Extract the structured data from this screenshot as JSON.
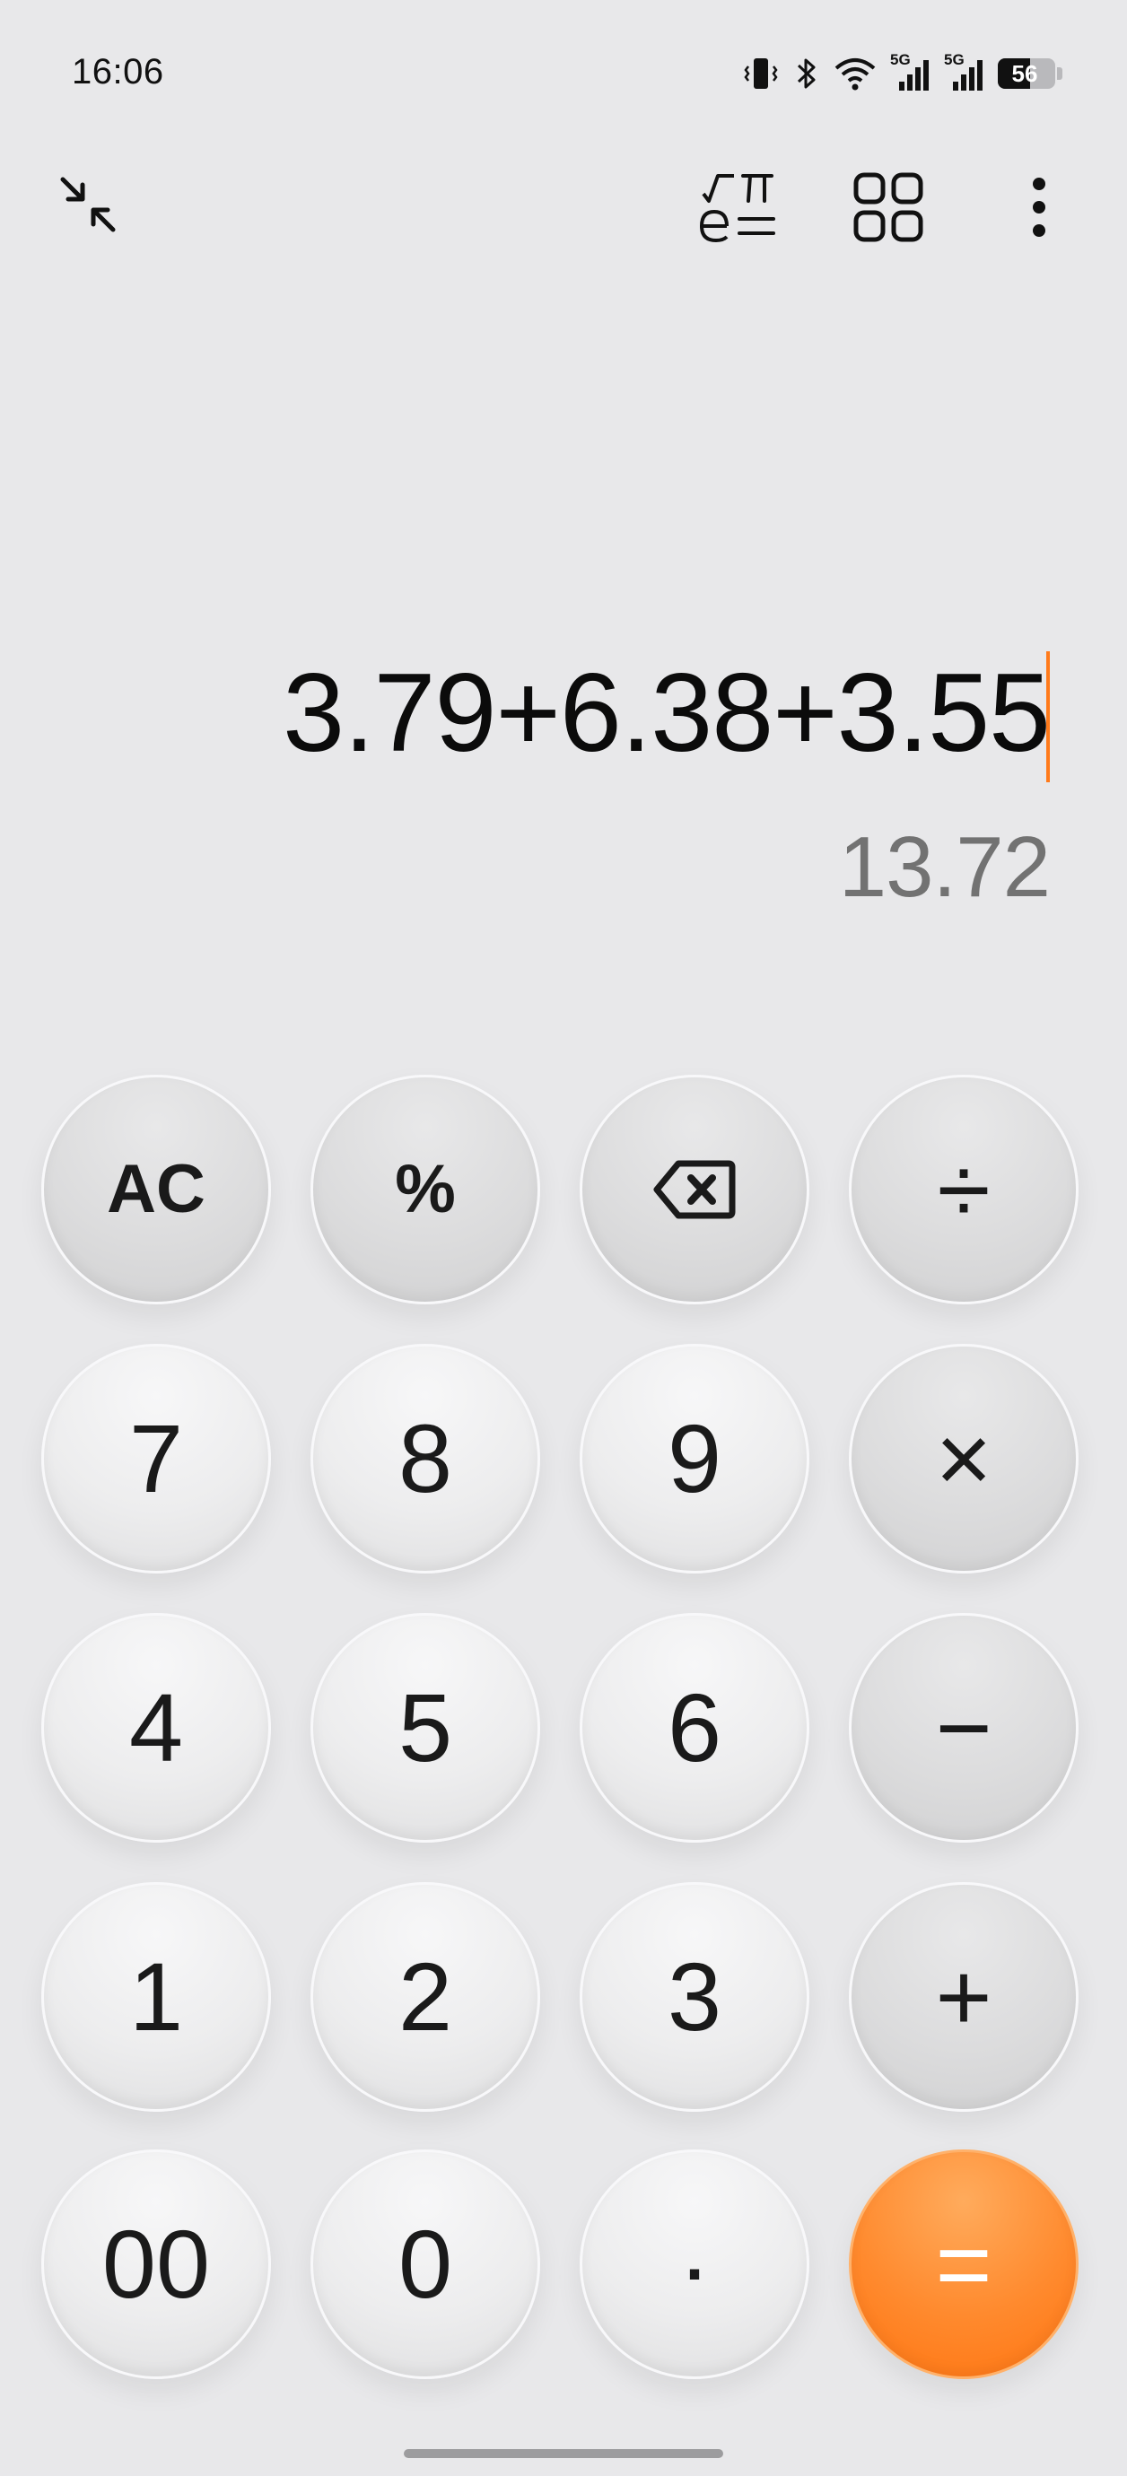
{
  "status_bar": {
    "time": "16:06",
    "network_1": "5G",
    "network_2": "5G",
    "battery": "56"
  },
  "toolbar": {
    "collapse": "collapse-icon",
    "scientific": "scientific-mode-icon",
    "converter": "grid-icon",
    "more": "more-vert-icon"
  },
  "display": {
    "expression": "3.79+6.38+3.55",
    "result": "13.72"
  },
  "keys": {
    "clear": "AC",
    "percent": "%",
    "backspace": "backspace-icon",
    "divide": "÷",
    "seven": "7",
    "eight": "8",
    "nine": "9",
    "multiply": "×",
    "four": "4",
    "five": "5",
    "six": "6",
    "subtract": "−",
    "one": "1",
    "two": "2",
    "three": "3",
    "add": "+",
    "double_zero": "00",
    "zero": "0",
    "decimal": ".",
    "equals": "="
  },
  "colors": {
    "accent": "#ff8a2e",
    "cursor": "#ff7a1a",
    "background": "#e8e8ea",
    "result_text": "#727272"
  }
}
